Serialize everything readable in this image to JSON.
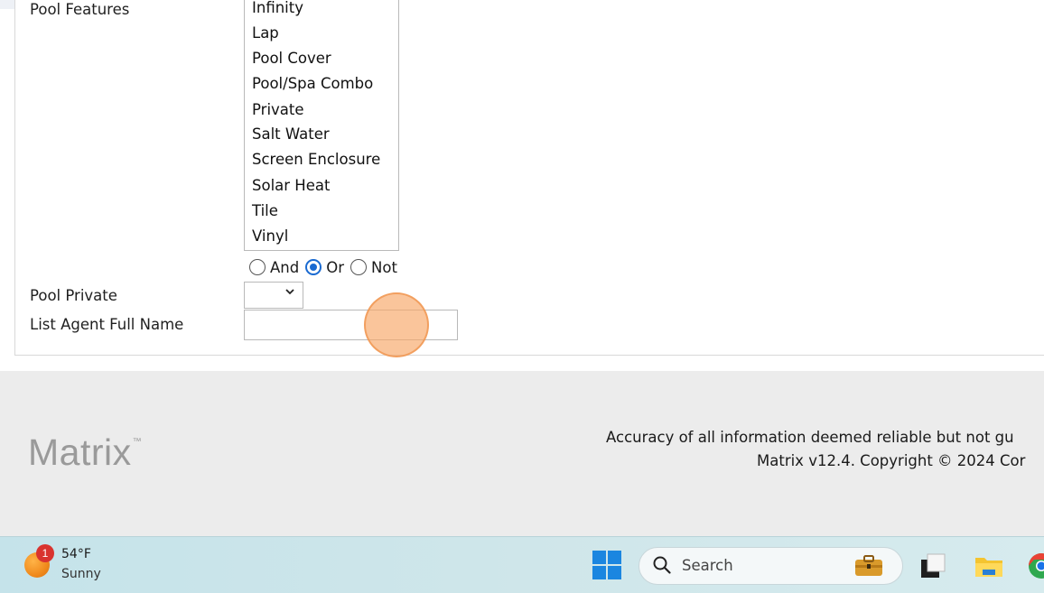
{
  "form": {
    "pool_features_label": "Pool Features",
    "pool_features_options": [
      "Infinity",
      "Lap",
      "Pool Cover",
      "Pool/Spa Combo",
      "Private",
      "Salt Water",
      "Screen Enclosure",
      "Solar Heat",
      "Tile",
      "Vinyl"
    ],
    "logic_options": {
      "and": "And",
      "or": "Or",
      "not": "Not"
    },
    "logic_selected": "Or",
    "pool_private_label": "Pool Private",
    "pool_private_value": "",
    "list_agent_label": "List Agent Full Name",
    "list_agent_value": ""
  },
  "footer": {
    "logo": "Matrix",
    "logo_tm": "™",
    "disclaimer": "Accuracy of all information deemed reliable but not gu",
    "copyright": "Matrix v12.4. Copyright © 2024 Cor"
  },
  "taskbar": {
    "weather_temp": "54°F",
    "weather_condition": "Sunny",
    "weather_badge": "1",
    "search_placeholder": "Search"
  },
  "icons": {
    "weather": "sun-cloud-icon",
    "start": "windows-start-icon",
    "search": "search-icon",
    "work": "briefcase-icon",
    "apps": [
      "task-view-icon",
      "file-explorer-icon",
      "chrome-icon"
    ]
  },
  "colors": {
    "accent_blue": "#1a6ad1",
    "footer_bg": "#ececec",
    "taskbar_bg": "#c5e3ea",
    "click_marker": "#f7a666"
  }
}
